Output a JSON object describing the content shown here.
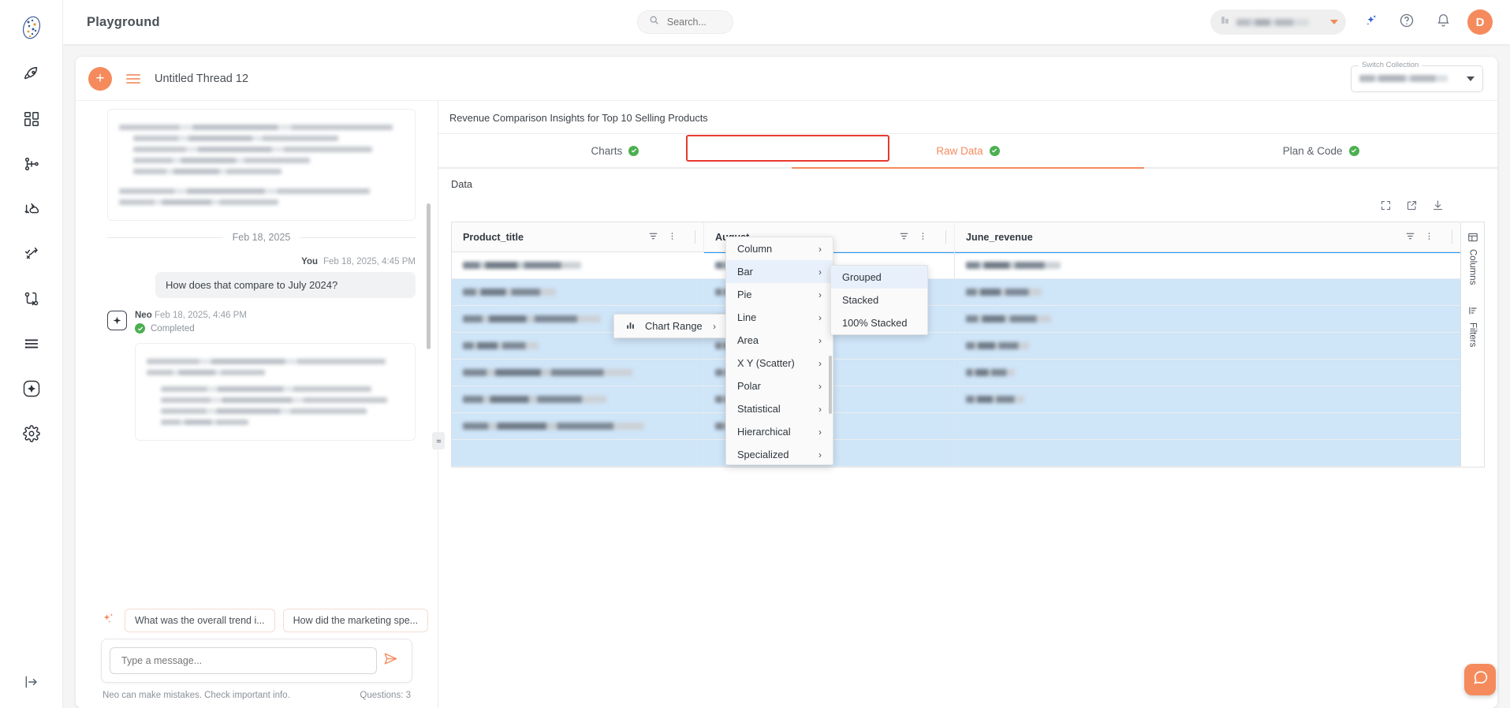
{
  "topbar": {
    "app_title": "Playground",
    "search_placeholder": "Search...",
    "org_selector_value": "",
    "avatar_initial": "D",
    "icons": {
      "sparkle": "sparkle-icon",
      "help": "help-icon",
      "bell": "bell-icon"
    }
  },
  "thread": {
    "new_label": "+",
    "title": "Untitled Thread 12",
    "switch_collection_label": "Switch Collection",
    "switch_collection_value": ""
  },
  "chat": {
    "date_separator": "Feb 18, 2025",
    "user_message": {
      "author": "You",
      "timestamp": "Feb 18, 2025, 4:45 PM",
      "text": "How does that compare to July 2024?"
    },
    "assistant_message": {
      "author": "Neo",
      "timestamp": "Feb 18, 2025, 4:46 PM",
      "status": "Completed"
    },
    "suggestions": [
      "What was the overall trend i...",
      "How did the marketing spe..."
    ],
    "composer_placeholder": "Type a message...",
    "disclaimer": "Neo can make mistakes. Check important info.",
    "questions_count": "Questions: 3"
  },
  "work": {
    "title": "Revenue Comparison Insights for Top 10 Selling Products",
    "tabs": [
      {
        "label": "Charts",
        "active": false,
        "status": "complete"
      },
      {
        "label": "Raw Data",
        "active": true,
        "status": "complete"
      },
      {
        "label": "Plan & Code",
        "active": false,
        "status": "complete"
      }
    ],
    "data_label": "Data",
    "grid_tools": [
      "expand-icon",
      "open-external-icon",
      "download-icon"
    ],
    "columns": [
      {
        "header": "Product_title"
      },
      {
        "header": "August"
      },
      {
        "header": "June_revenue"
      }
    ],
    "row_count": 8,
    "side_tabs": [
      {
        "label": "Columns",
        "icon": "table-columns-icon"
      },
      {
        "label": "Filters",
        "icon": "filter-icon"
      }
    ]
  },
  "context_menu": {
    "chart_range": {
      "label": "Chart Range",
      "icon": "bar-chart-icon",
      "arrow": "›"
    },
    "chart_types": [
      {
        "label": "Column",
        "highlighted": false
      },
      {
        "label": "Bar",
        "highlighted": true
      },
      {
        "label": "Pie",
        "highlighted": false
      },
      {
        "label": "Line",
        "highlighted": false
      },
      {
        "label": "Area",
        "highlighted": false
      },
      {
        "label": "X Y (Scatter)",
        "highlighted": false
      },
      {
        "label": "Polar",
        "highlighted": false
      },
      {
        "label": "Statistical",
        "highlighted": false
      },
      {
        "label": "Hierarchical",
        "highlighted": false
      },
      {
        "label": "Specialized",
        "highlighted": false
      }
    ],
    "bar_subtypes": [
      {
        "label": "Grouped",
        "highlighted": true
      },
      {
        "label": "Stacked",
        "highlighted": false
      },
      {
        "label": "100% Stacked",
        "highlighted": false
      }
    ]
  },
  "colors": {
    "accent": "#f58b5d",
    "highlight_ring": "#e8392f",
    "row_selection": "#cfe5f8",
    "status_green": "#4caf50"
  }
}
